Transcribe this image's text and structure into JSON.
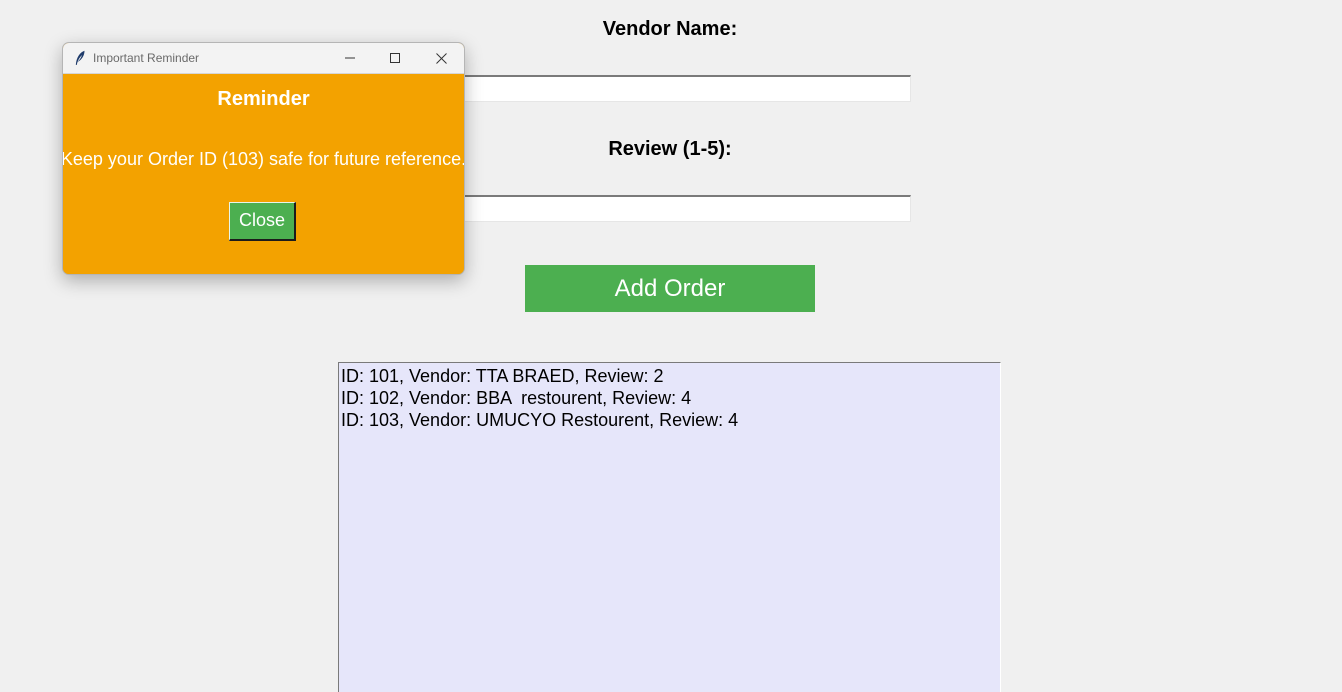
{
  "form": {
    "vendor_label": "Vendor Name:",
    "vendor_value": "",
    "review_label": "Review (1-5):",
    "review_value": "",
    "add_button": "Add Order"
  },
  "orders": [
    "ID: 101, Vendor: TTA BRAED, Review: 2",
    "ID: 102, Vendor: BBA  restourent, Review: 4",
    "ID: 103, Vendor: UMUCYO Restourent, Review: 4"
  ],
  "popup": {
    "window_title": "Important Reminder",
    "heading": "Reminder",
    "message": "Keep your Order ID (103) safe for future reference.",
    "close_button": "Close",
    "icons": {
      "app": "feather-icon",
      "minimize": "minimize-icon",
      "maximize": "maximize-icon",
      "close": "close-icon"
    }
  },
  "colors": {
    "background": "#f0f0f0",
    "popup_background": "#f3a200",
    "button_green": "#4caf50",
    "listbox_background": "#e6e6fa"
  }
}
